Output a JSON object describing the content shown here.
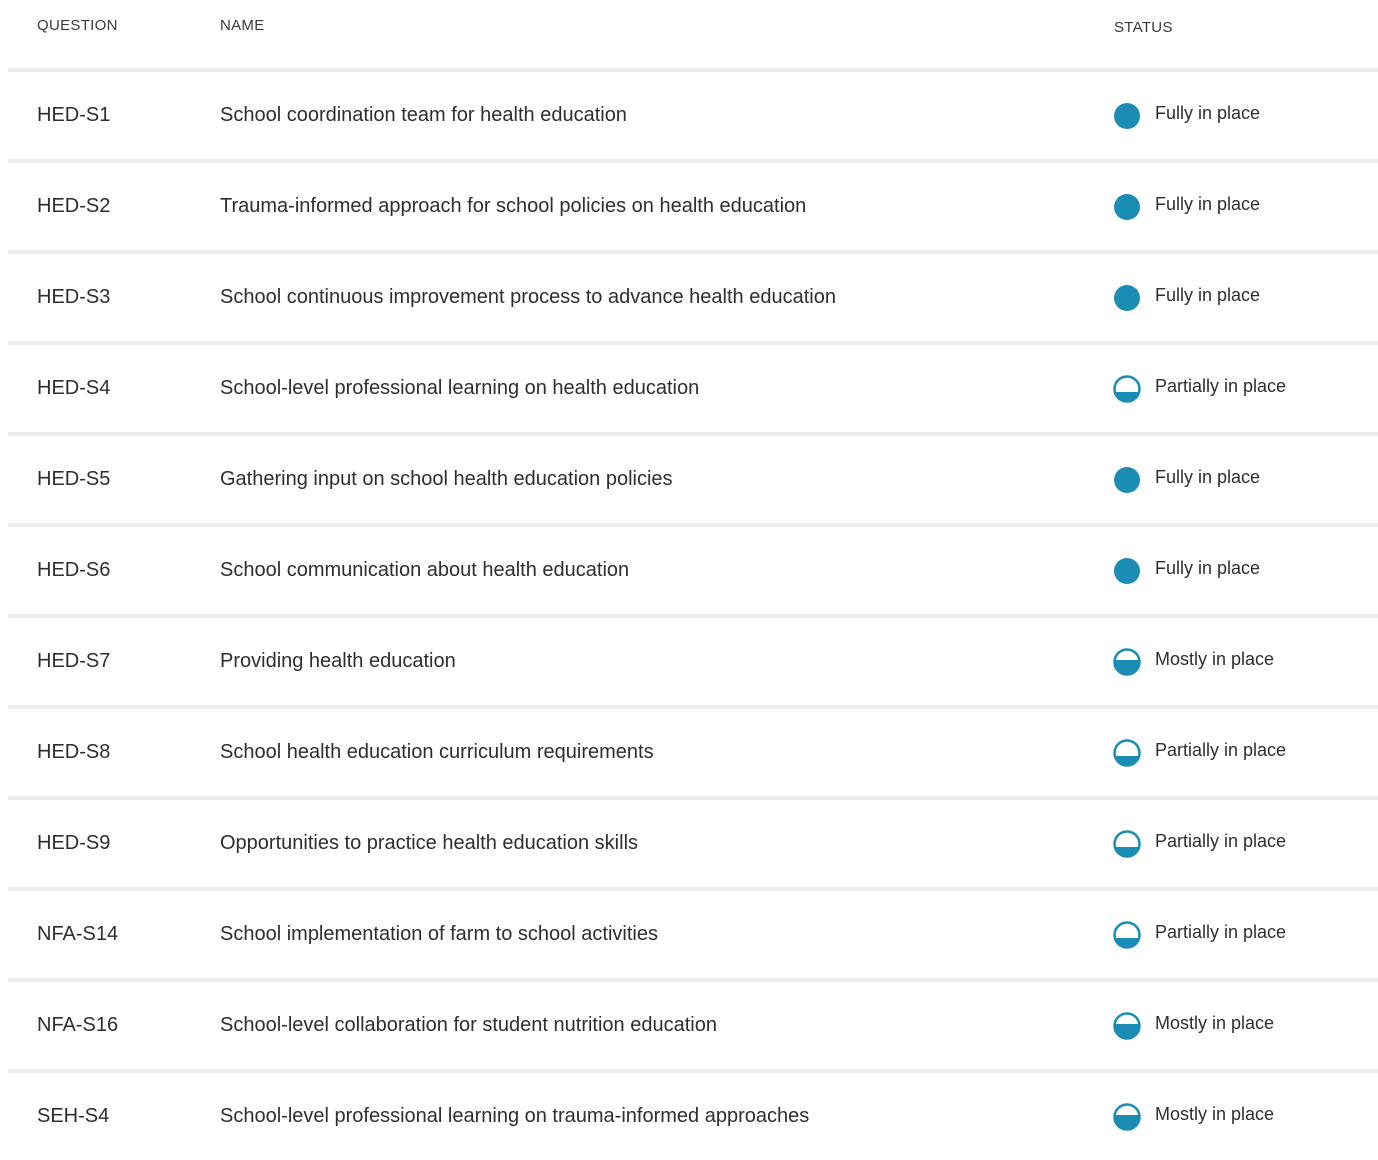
{
  "header": {
    "question": "QUESTION",
    "name": "NAME",
    "status": "STATUS"
  },
  "colors": {
    "accent": "#1b8db5",
    "divider": "#ececec"
  },
  "status_icons": {
    "Fully in place": "full-circle-icon",
    "Mostly in place": "mostly-filled-circle-icon",
    "Partially in place": "partially-filled-circle-icon"
  },
  "rows": [
    {
      "question": "HED-S1",
      "name": "School coordination team for health education",
      "status": "Fully in place",
      "level": "full"
    },
    {
      "question": "HED-S2",
      "name": "Trauma-informed approach for school policies on health education",
      "status": "Fully in place",
      "level": "full"
    },
    {
      "question": "HED-S3",
      "name": "School continuous improvement process to advance health education",
      "status": "Fully in place",
      "level": "full"
    },
    {
      "question": "HED-S4",
      "name": "School-level professional learning on health education",
      "status": "Partially in place",
      "level": "partial"
    },
    {
      "question": "HED-S5",
      "name": "Gathering input on school health education policies",
      "status": "Fully in place",
      "level": "full"
    },
    {
      "question": "HED-S6",
      "name": "School communication about health education",
      "status": "Fully in place",
      "level": "full"
    },
    {
      "question": "HED-S7",
      "name": "Providing health education",
      "status": "Mostly in place",
      "level": "mostly"
    },
    {
      "question": "HED-S8",
      "name": "School health education curriculum requirements",
      "status": "Partially in place",
      "level": "partial"
    },
    {
      "question": "HED-S9",
      "name": "Opportunities to practice health education skills",
      "status": "Partially in place",
      "level": "partial"
    },
    {
      "question": "NFA-S14",
      "name": "School implementation of farm to school activities",
      "status": "Partially in place",
      "level": "partial"
    },
    {
      "question": "NFA-S16",
      "name": "School-level collaboration for student nutrition education",
      "status": "Mostly in place",
      "level": "mostly"
    },
    {
      "question": "SEH-S4",
      "name": "School-level professional learning on trauma-informed approaches",
      "status": "Mostly in place",
      "level": "mostly"
    }
  ]
}
